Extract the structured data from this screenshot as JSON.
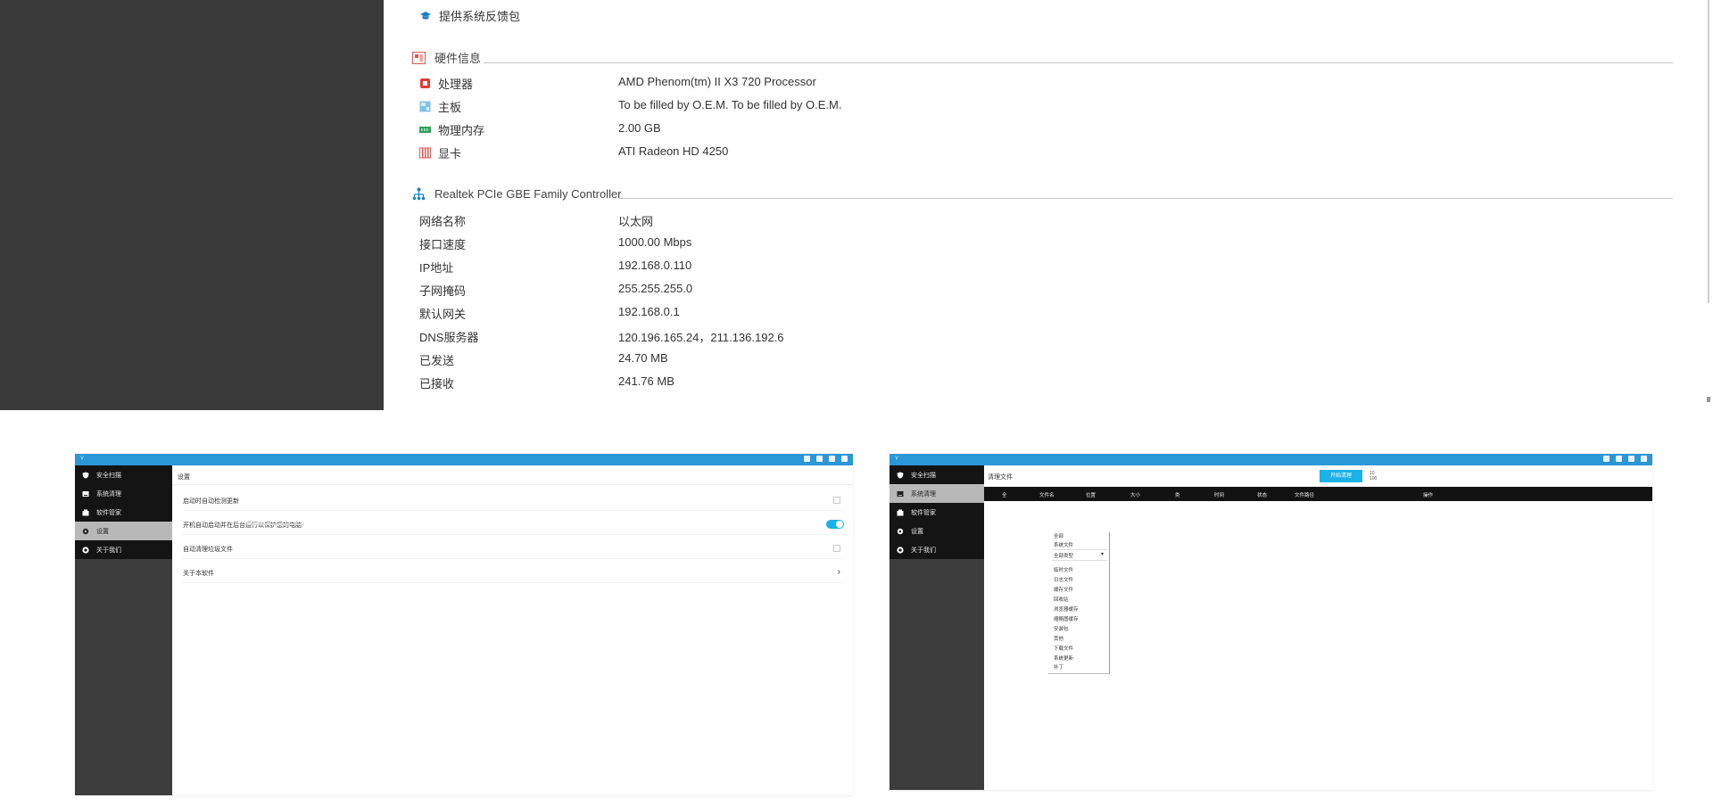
{
  "top": {
    "header_link": "提供系统反馈包",
    "hardware": {
      "title": "硬件信息",
      "rows": [
        {
          "icon": "cpu-icon",
          "label": "处理器",
          "value": "AMD Phenom(tm) II X3 720 Processor"
        },
        {
          "icon": "motherboard-icon",
          "label": "主板",
          "value": "To be filled by O.E.M. To be filled by O.E.M."
        },
        {
          "icon": "memory-icon",
          "label": "物理内存",
          "value": "2.00 GB"
        },
        {
          "icon": "graphics-card-icon",
          "label": "显卡",
          "value": "ATI Radeon HD 4250"
        }
      ]
    },
    "network": {
      "title": "Realtek PCIe GBE Family Controller",
      "rows": [
        {
          "label": "网络名称",
          "value": "以太网"
        },
        {
          "label": "接口速度",
          "value": "1000.00 Mbps"
        },
        {
          "label": "IP地址",
          "value": "192.168.0.110"
        },
        {
          "label": "子网掩码",
          "value": "255.255.255.0"
        },
        {
          "label": "默认网关",
          "value": "192.168.0.1"
        },
        {
          "label": "DNS服务器",
          "value": "120.196.165.24，211.136.192.6"
        },
        {
          "label": "已发送",
          "value": "24.70 MB"
        },
        {
          "label": "已接收",
          "value": "241.76 MB"
        }
      ]
    }
  },
  "left_window": {
    "title": "Y",
    "sidebar": [
      {
        "icon": "shield-icon",
        "label": "安全扫描"
      },
      {
        "icon": "drive-icon",
        "label": "系统清理"
      },
      {
        "icon": "store-icon",
        "label": "软件管家"
      },
      {
        "icon": "gear-icon",
        "label": "设置"
      },
      {
        "icon": "info-icon",
        "label": "关于我们"
      }
    ],
    "active_index": 3,
    "header": "设置",
    "settings": [
      {
        "label": "启动时自动检测更新",
        "control": "checkbox"
      },
      {
        "label": "开机自动启动并在后台运行以保护您的电脑",
        "control": "toggle",
        "on": true
      },
      {
        "label": "自动清理垃圾文件",
        "control": "checkbox"
      },
      {
        "label": "关于本软件",
        "control": "chevron"
      }
    ],
    "accent": "#2a97d7",
    "toggle_color": "#1ab0e8"
  },
  "right_window": {
    "title": "Y",
    "sidebar": [
      {
        "icon": "shield-icon",
        "label": "安全扫描"
      },
      {
        "icon": "drive-icon",
        "label": "系统清理"
      },
      {
        "icon": "store-icon",
        "label": "软件管家"
      },
      {
        "icon": "gear-icon",
        "label": "设置"
      },
      {
        "icon": "info-icon",
        "label": "关于我们"
      }
    ],
    "active_index": 1,
    "header": "清理文件",
    "action_button": "开始清理",
    "action_stat_top": "10",
    "action_stat_bottom": "100",
    "columns": [
      "全",
      "文件名",
      "位置",
      "大小",
      "类",
      "时间",
      "状态",
      "文件路径",
      "操作"
    ],
    "dropdown": {
      "title": "全部",
      "subtitle": "系统文件",
      "selected": "全部类型",
      "options": [
        "临时文件",
        "日志文件",
        "缓存文件",
        "回收站",
        "浏览器缓存",
        "缩略图缓存",
        "安装包",
        "其他",
        "下载文件",
        "系统更新",
        "补丁"
      ]
    },
    "button_color": "#1ab0e8"
  }
}
